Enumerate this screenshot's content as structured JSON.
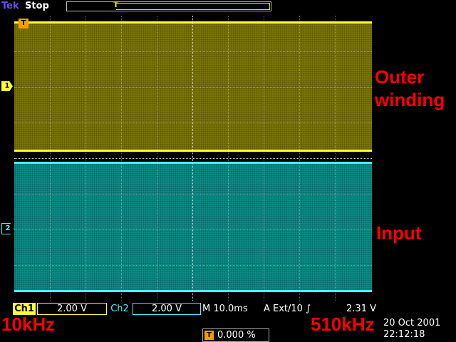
{
  "header": {
    "brand": "Tek",
    "status": "Stop",
    "trigger_position_marker": "T"
  },
  "screen": {
    "ch1_marker": "1",
    "ch2_marker": "2",
    "trigger_marker": "T",
    "ch1_color": "#ffff33",
    "ch2_color": "#4ef0ff"
  },
  "annotations": {
    "outer_line1": "Outer",
    "outer_line2": "winding",
    "input": "Input",
    "start_freq": "10kHz",
    "end_freq": "510kHz"
  },
  "readout": {
    "ch1_label": "Ch1",
    "ch1_scale": "2.00 V",
    "ch2_label": "Ch2",
    "ch2_scale": "2.00 V",
    "timebase": "M 10.0ms",
    "trigger": "A Ext/10 ∫",
    "trigger_level": "2.31 V"
  },
  "trigger_offset": {
    "icon": "T",
    "value": "0.000 %"
  },
  "datetime": {
    "date": "20 Oct  2001",
    "time": "22:12:18"
  }
}
